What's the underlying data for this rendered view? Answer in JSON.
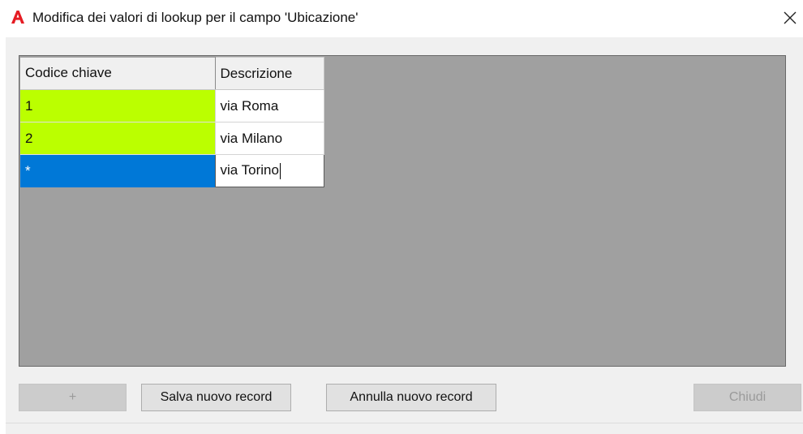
{
  "window": {
    "title": "Modifica dei valori di lookup per il campo 'Ubicazione'",
    "app_icon": "autocad-icon",
    "close_icon": "close-icon",
    "accent_color": "#e51c23"
  },
  "grid": {
    "columns": [
      "Codice chiave",
      "Descrizione"
    ],
    "rows": [
      {
        "key": "1",
        "description": "via Roma"
      },
      {
        "key": "2",
        "description": "via Milano"
      }
    ],
    "new_row": {
      "key": "*",
      "description": "via Torino"
    },
    "colors": {
      "key_cell": "#bbff00",
      "selected_cell": "#0078d7",
      "empty_area": "#a0a0a0"
    }
  },
  "buttons": {
    "add": {
      "label": "+",
      "enabled": false
    },
    "save": {
      "label": "Salva nuovo record",
      "enabled": true
    },
    "cancel": {
      "label": "Annulla nuovo record",
      "enabled": true
    },
    "close": {
      "label": "Chiudi",
      "enabled": false
    }
  }
}
